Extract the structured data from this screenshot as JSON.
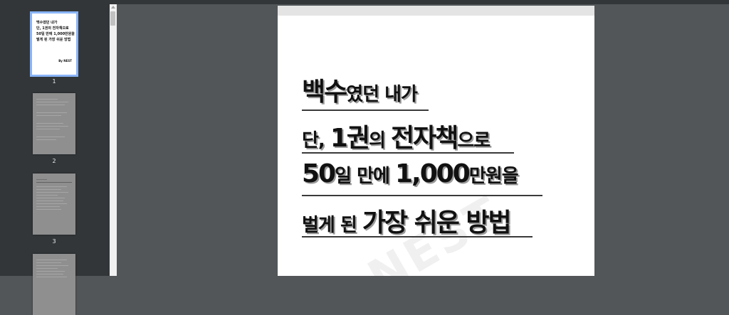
{
  "thumbnails": [
    {
      "label": "1",
      "selected": true,
      "title": "백수였던 내가\n단, 1권의 전자책으로\n50일 만에 1,000만원을\n벌게 된 가장 쉬운 방법",
      "byline": "By NEST"
    },
    {
      "label": "2",
      "selected": false
    },
    {
      "label": "3",
      "selected": false
    },
    {
      "label": "",
      "selected": false
    }
  ],
  "document": {
    "title_lines": [
      {
        "parts": [
          {
            "text": "백수",
            "size": "big"
          },
          {
            "text": "였던 내가",
            "size": "small"
          }
        ]
      },
      {
        "parts": [
          {
            "text": "단, ",
            "size": "small"
          },
          {
            "text": "1권",
            "size": "big"
          },
          {
            "text": "의 ",
            "size": "small"
          },
          {
            "text": "전자책",
            "size": "big"
          },
          {
            "text": "으로",
            "size": "small"
          }
        ]
      },
      {
        "parts": [
          {
            "text": "50",
            "size": "big"
          },
          {
            "text": "일 만에 ",
            "size": "small"
          },
          {
            "text": "1,000",
            "size": "big"
          },
          {
            "text": "만원을",
            "size": "small"
          }
        ]
      },
      {
        "parts": [
          {
            "text": "벌게 된 ",
            "size": "small"
          },
          {
            "text": "가장 쉬운 방법",
            "size": "big"
          }
        ]
      }
    ],
    "watermark": "NEST"
  },
  "colors": {
    "viewer_background": "#525659",
    "sidebar_background": "#323639",
    "selection_accent": "#8ab4f8"
  }
}
